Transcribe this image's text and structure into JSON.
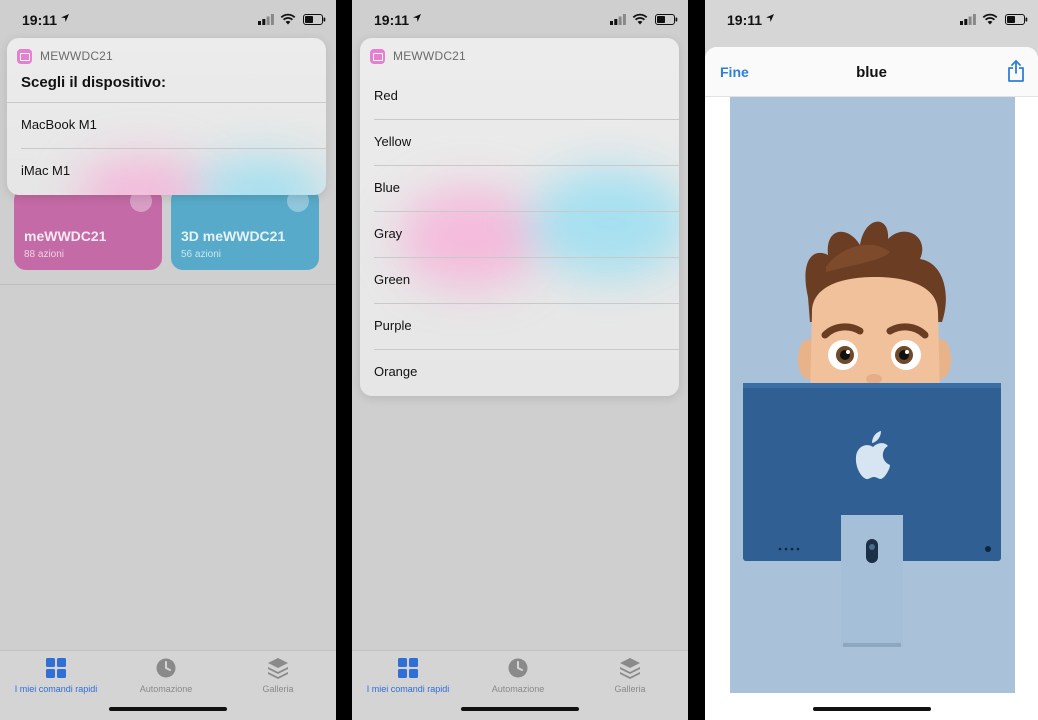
{
  "status_bar": {
    "time": "19:11"
  },
  "home": {
    "cards": [
      {
        "title": "meWWDC21",
        "subtitle": "88 azioni",
        "color": "#c46aa6"
      },
      {
        "title": "3D meWWDC21",
        "subtitle": "56 azioni",
        "color": "#57aac9"
      }
    ]
  },
  "tabbar": {
    "tabs": [
      {
        "label": "I miei comandi rapidi",
        "icon": "grid-icon",
        "active": true
      },
      {
        "label": "Automazione",
        "icon": "clock-icon",
        "active": false
      },
      {
        "label": "Galleria",
        "icon": "stack-icon",
        "active": false
      }
    ]
  },
  "device_menu": {
    "app_name": "MEWWDC21",
    "question": "Scegli il dispositivo:",
    "options": [
      "MacBook M1",
      "iMac M1"
    ]
  },
  "color_menu": {
    "app_name": "MEWWDC21",
    "options": [
      "Red",
      "Yellow",
      "Blue",
      "Gray",
      "Green",
      "Purple",
      "Orange"
    ]
  },
  "preview": {
    "done_label": "Fine",
    "title": "blue",
    "image_description_icon": "memoji-behind-imac-image"
  },
  "colors": {
    "accent": "#2f6fd6",
    "app_badge": "#e77fd0",
    "imac_blue": "#2f5f93",
    "image_bg": "#a9c2d9"
  }
}
